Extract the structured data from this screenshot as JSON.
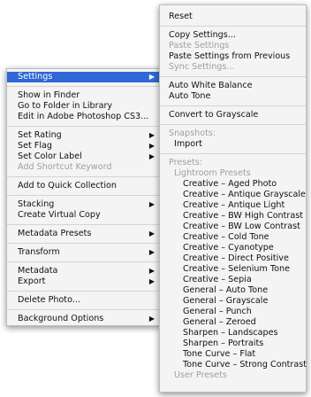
{
  "main_menu": {
    "groups": [
      [
        {
          "label": "Settings",
          "submenu": true,
          "selected": true
        }
      ],
      [
        {
          "label": "Show in Finder"
        },
        {
          "label": "Go to Folder in Library"
        },
        {
          "label": "Edit in Adobe Photoshop CS3..."
        }
      ],
      [
        {
          "label": "Set Rating",
          "submenu": true
        },
        {
          "label": "Set Flag",
          "submenu": true
        },
        {
          "label": "Set Color Label",
          "submenu": true
        },
        {
          "label": "Add Shortcut Keyword",
          "disabled": true
        }
      ],
      [
        {
          "label": "Add to Quick Collection"
        }
      ],
      [
        {
          "label": "Stacking",
          "submenu": true
        },
        {
          "label": "Create Virtual Copy"
        }
      ],
      [
        {
          "label": "Metadata Presets",
          "submenu": true
        }
      ],
      [
        {
          "label": "Transform",
          "submenu": true
        }
      ],
      [
        {
          "label": "Metadata",
          "submenu": true
        },
        {
          "label": "Export",
          "submenu": true
        }
      ],
      [
        {
          "label": "Delete Photo..."
        }
      ],
      [
        {
          "label": "Background Options",
          "submenu": true
        }
      ]
    ]
  },
  "settings_menu": {
    "groups": [
      [
        {
          "label": "Reset"
        }
      ],
      [
        {
          "label": "Copy Settings..."
        },
        {
          "label": "Paste Settings",
          "disabled": true
        },
        {
          "label": "Paste Settings from Previous"
        },
        {
          "label": "Sync Settings...",
          "disabled": true
        }
      ],
      [
        {
          "label": "Auto White Balance"
        },
        {
          "label": "Auto Tone"
        }
      ],
      [
        {
          "label": "Convert to Grayscale"
        }
      ],
      [
        {
          "label": "Snapshots:",
          "header": true
        },
        {
          "label": "Import",
          "indent": 1
        }
      ],
      [
        {
          "label": "Presets:",
          "header": true
        },
        {
          "label": "Lightroom Presets",
          "header": true,
          "indent": 1
        },
        {
          "label": "Creative – Aged Photo",
          "indent": 2
        },
        {
          "label": "Creative – Antique Grayscale",
          "indent": 2
        },
        {
          "label": "Creative – Antique Light",
          "indent": 2
        },
        {
          "label": "Creative – BW High Contrast",
          "indent": 2
        },
        {
          "label": "Creative – BW Low Contrast",
          "indent": 2
        },
        {
          "label": "Creative – Cold Tone",
          "indent": 2
        },
        {
          "label": "Creative – Cyanotype",
          "indent": 2
        },
        {
          "label": "Creative – Direct Positive",
          "indent": 2
        },
        {
          "label": "Creative – Selenium Tone",
          "indent": 2
        },
        {
          "label": "Creative – Sepia",
          "indent": 2
        },
        {
          "label": "General – Auto Tone",
          "indent": 2
        },
        {
          "label": "General – Grayscale",
          "indent": 2
        },
        {
          "label": "General – Punch",
          "indent": 2
        },
        {
          "label": "General – Zeroed",
          "indent": 2
        },
        {
          "label": "Sharpen – Landscapes",
          "indent": 2
        },
        {
          "label": "Sharpen – Portraits",
          "indent": 2
        },
        {
          "label": "Tone Curve – Flat",
          "indent": 2
        },
        {
          "label": "Tone Curve – Strong Contrast",
          "indent": 2
        },
        {
          "label": "User Presets",
          "header": true,
          "indent": 1
        }
      ]
    ]
  },
  "icons": {
    "submenu_arrow": "triangle-right-icon"
  },
  "colors": {
    "selection": "#2f67d6",
    "menu_bg": "#f4f4f4",
    "disabled_text": "#a0a0a0"
  }
}
